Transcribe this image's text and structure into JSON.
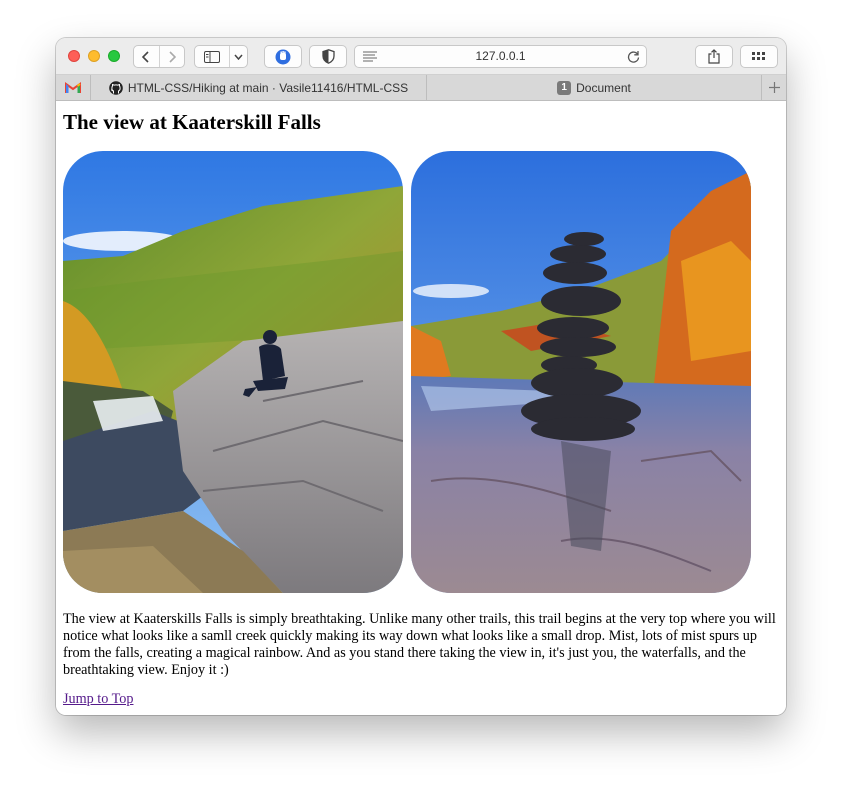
{
  "browser": {
    "address": {
      "url": "127.0.0.1"
    },
    "tabs": [
      {
        "label": "",
        "icon": "gmail-icon"
      },
      {
        "label": "HTML-CSS/Hiking at main · Vasile11416/HTML-CSS",
        "icon": "github-icon"
      },
      {
        "label": "Document",
        "badge": "1"
      }
    ]
  },
  "page": {
    "title": "The view at Kaaterskill Falls",
    "images": [
      {
        "subject": "hiker-on-rock-photo"
      },
      {
        "subject": "rock-cairn-photo"
      }
    ],
    "description": "The view at Kaaterskills Falls is simply breathtaking. Unlike many other trails, this trail begins at the very top where you will notice what looks like a samll creek quickly making its way down what looks like a small drop. Mist, lots of mist spurs up from the falls, creating a magical rainbow. And as you stand there taking the view in, it's just you, the waterfalls, and the breathtaking view. Enjoy it :)",
    "jump_link": "Jump to Top"
  },
  "colors": {
    "link": "#551a8b",
    "sky": "#3f87e8"
  }
}
